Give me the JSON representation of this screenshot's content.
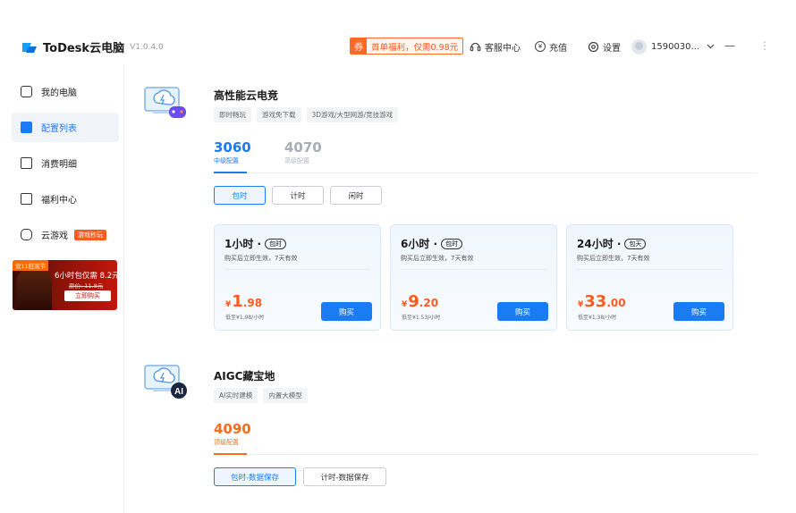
{
  "app": {
    "name": "ToDesk云电脑",
    "version": "V1.0.4.0"
  },
  "titlebar": {
    "promo": {
      "icon_text": "券",
      "text": "首单福利，仅需0.98元"
    },
    "support": "客服中心",
    "recharge": "充值",
    "settings": "设置",
    "user": "1590030...",
    "minimize": "—",
    "overflow": "⋮"
  },
  "sidebar": {
    "items": [
      {
        "label": "我的电脑",
        "icon": "monitor-icon"
      },
      {
        "label": "配置列表",
        "icon": "clipboard-icon"
      },
      {
        "label": "消费明细",
        "icon": "receipt-icon"
      },
      {
        "label": "福利中心",
        "icon": "gift-icon"
      },
      {
        "label": "云游戏",
        "icon": "gamepad-icon",
        "badge": "游戏秒玩"
      }
    ],
    "banner": {
      "tag": "双11狂欢节",
      "main": "6小时包仅需 8.2元",
      "strike": "原价: 11.8元",
      "button": "立即购买"
    }
  },
  "sections": [
    {
      "title": "高性能云电竞",
      "tags": [
        "即时畅玩",
        "游戏免下载",
        "3D游戏/大型网游/竞技游戏"
      ],
      "configs": [
        {
          "name": "3060",
          "tier": "中级配置"
        },
        {
          "name": "4070",
          "tier": "高级配置"
        }
      ],
      "modes": [
        "包时",
        "计时",
        "闲时"
      ],
      "plans": [
        {
          "duration": "1小时 ·",
          "pill": "包时",
          "note": "购买后立即生效，7天有效",
          "currency": "¥",
          "price_int": "1",
          "price_dec": ".98",
          "low": "低至¥1.98/小时",
          "buy": "购买"
        },
        {
          "duration": "6小时 ·",
          "pill": "包时",
          "note": "购买后立即生效，7天有效",
          "currency": "¥",
          "price_int": "9",
          "price_dec": ".20",
          "low": "低至¥1.53/小时",
          "buy": "购买"
        },
        {
          "duration": "24小时 ·",
          "pill": "包天",
          "note": "购买后立即生效，7天有效",
          "currency": "¥",
          "price_int": "33",
          "price_dec": ".00",
          "low": "低至¥1.38/小时",
          "buy": "购买"
        }
      ]
    },
    {
      "title": "AIGC藏宝地",
      "tags": [
        "AI实时建模",
        "内置大模型"
      ],
      "configs": [
        {
          "name": "4090",
          "tier": "顶级配置"
        }
      ],
      "modes": [
        "包时-数据保存",
        "计时-数据保存"
      ]
    }
  ],
  "colors": {
    "accent": "#1a7cf5",
    "orange": "#ff5a1f"
  }
}
